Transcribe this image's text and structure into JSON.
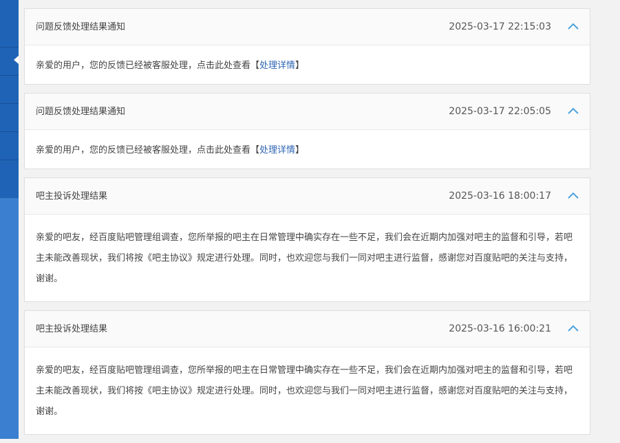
{
  "colors": {
    "sidebar_light": "#3b7fd0",
    "sidebar_dark": "#1f63b6",
    "accent": "#4aa3df",
    "link": "#2d64b3"
  },
  "icons": {
    "collapse": "chevron-up-icon"
  },
  "notifications": [
    {
      "title": "问题反馈处理结果通知",
      "time": "2025-03-17 22:15:03",
      "body": "亲爱的用户，您的反馈已经被客服处理，点击此处查看",
      "link_open": "【",
      "link_text": "处理详情",
      "link_close": "】"
    },
    {
      "title": "问题反馈处理结果通知",
      "time": "2025-03-17 22:05:05",
      "body": "亲爱的用户，您的反馈已经被客服处理，点击此处查看",
      "link_open": "【",
      "link_text": "处理详情",
      "link_close": "】"
    },
    {
      "title": "吧主投诉处理结果",
      "time": "2025-03-16 18:00:17",
      "body": "亲爱的吧友，经百度贴吧管理组调查，您所举报的吧主在日常管理中确实存在一些不足，我们会在近期内加强对吧主的监督和引导，若吧主未能改善现状，我们将按《吧主协议》规定进行处理。同时，也欢迎您与我们一同对吧主进行监督，感谢您对百度贴吧的关注与支持，谢谢。"
    },
    {
      "title": "吧主投诉处理结果",
      "time": "2025-03-16 16:00:21",
      "body": "亲爱的吧友，经百度贴吧管理组调查，您所举报的吧主在日常管理中确实存在一些不足，我们会在近期内加强对吧主的监督和引导，若吧主未能改善现状，我们将按《吧主协议》规定进行处理。同时，也欢迎您与我们一同对吧主进行监督，感谢您对百度贴吧的关注与支持，谢谢。"
    }
  ]
}
